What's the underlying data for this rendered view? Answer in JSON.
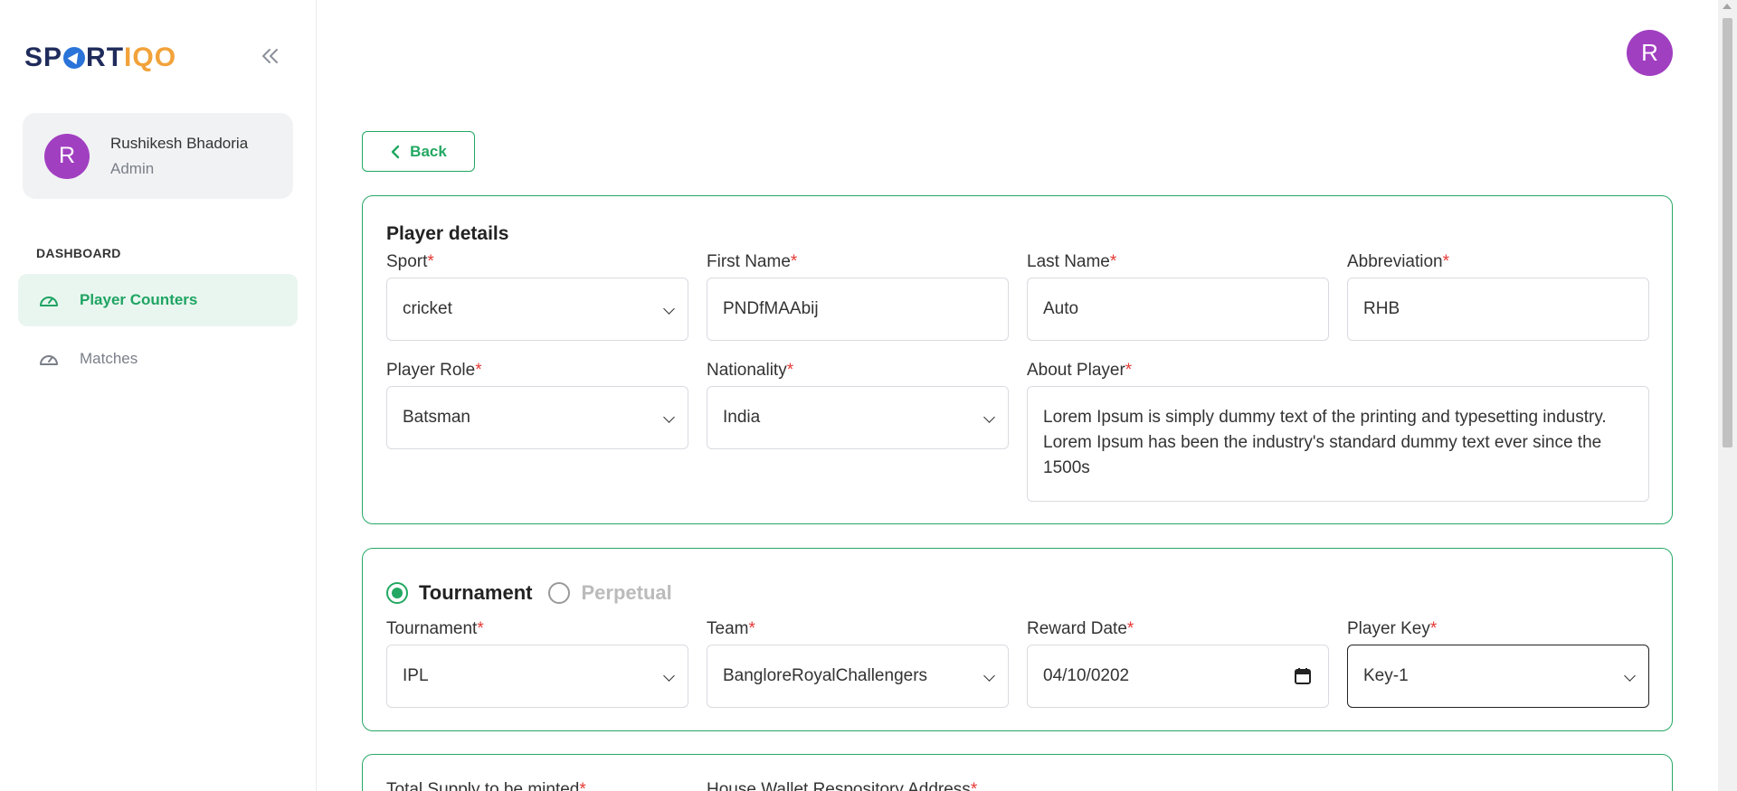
{
  "brand": {
    "name_part1": "SP",
    "name_part2": "RT",
    "name_part3": "IQO"
  },
  "sidebar": {
    "collapse_icon": "double-chevron-left-icon",
    "user": {
      "initial": "R",
      "name": "Rushikesh Bhadoria",
      "role": "Admin"
    },
    "section_label": "DASHBOARD",
    "items": [
      {
        "label": "Player Counters",
        "icon": "gauge-icon",
        "active": true
      },
      {
        "label": "Matches",
        "icon": "gauge-icon",
        "active": false
      }
    ]
  },
  "header": {
    "avatar_initial": "R"
  },
  "back_label": "Back",
  "player_details": {
    "title": "Player details",
    "sport": {
      "label": "Sport",
      "value": "cricket"
    },
    "first_name": {
      "label": "First Name",
      "value": "PNDfMAAbij"
    },
    "last_name": {
      "label": "Last Name",
      "value": "Auto"
    },
    "abbreviation": {
      "label": "Abbreviation",
      "value": "RHB"
    },
    "player_role": {
      "label": "Player Role",
      "value": "Batsman"
    },
    "nationality": {
      "label": "Nationality",
      "value": "India"
    },
    "about_player": {
      "label": "About Player",
      "value": "Lorem Ipsum is simply dummy text of the printing and typesetting industry. Lorem Ipsum has been the industry's standard dummy text ever since the 1500s"
    }
  },
  "reward": {
    "type_options": [
      {
        "label": "Tournament",
        "selected": true
      },
      {
        "label": "Perpetual",
        "selected": false
      }
    ],
    "tournament": {
      "label": "Tournament",
      "value": "IPL"
    },
    "team": {
      "label": "Team",
      "value": "BangloreRoyalChallengers"
    },
    "reward_date": {
      "label": "Reward Date",
      "value": "04/10/0202"
    },
    "player_key": {
      "label": "Player Key",
      "value": "Key-1"
    }
  },
  "supply": {
    "total_supply": {
      "label": "Total Supply to be minted"
    },
    "house_wallet": {
      "label": "House Wallet Respository Address"
    }
  },
  "required_marker": "*",
  "colors": {
    "accent": "#22a862",
    "avatar": "#a13fc1",
    "required": "#e53935"
  }
}
